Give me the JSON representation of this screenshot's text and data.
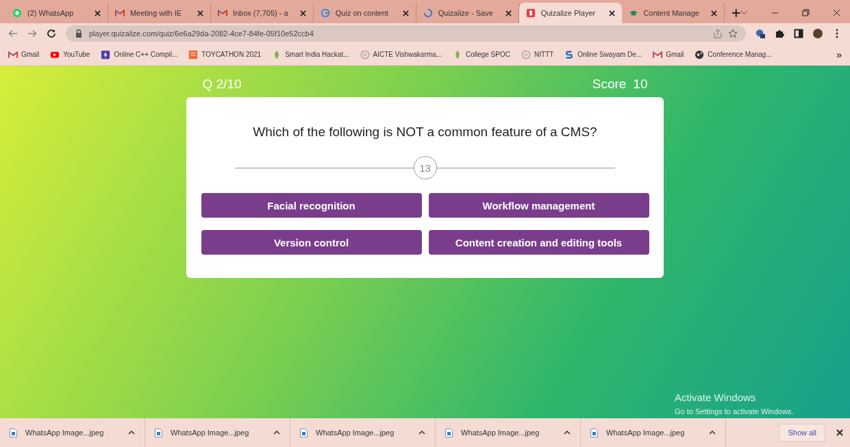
{
  "tabs": [
    {
      "title": "(2) WhatsApp",
      "kind": "whatsapp",
      "selected": false
    },
    {
      "title": "Meeting with IE",
      "kind": "gmail",
      "selected": false
    },
    {
      "title": "Inbox (7,705) - a",
      "kind": "gmail",
      "selected": false
    },
    {
      "title": "Quiz on content",
      "kind": "google",
      "selected": false
    },
    {
      "title": "Quizalize - Save",
      "kind": "loading",
      "selected": false
    },
    {
      "title": "Quizalize Player",
      "kind": "quizalize",
      "selected": true
    },
    {
      "title": "Content Manage",
      "kind": "cap",
      "selected": false
    }
  ],
  "address": {
    "url": "player.quizalize.com/quiz/6e6a29da-2082-4ce7-84fe-05f10e52ccb4"
  },
  "bookmarks": [
    {
      "label": "Gmail",
      "kind": "gmail"
    },
    {
      "label": "YouTube",
      "kind": "youtube"
    },
    {
      "label": "Online C++ Compil...",
      "kind": "compiler"
    },
    {
      "label": "TOYCATHON 2021",
      "kind": "toy"
    },
    {
      "label": "Smart India Hackat...",
      "kind": "leaf"
    },
    {
      "label": "AICTE Vishwakarma...",
      "kind": "globe"
    },
    {
      "label": "College SPOC",
      "kind": "leaf"
    },
    {
      "label": "NITTT",
      "kind": "globe"
    },
    {
      "label": "Online Swayam De...",
      "kind": "swayam"
    },
    {
      "label": "Gmail",
      "kind": "gmail"
    },
    {
      "label": "Conference Manag...",
      "kind": "world"
    }
  ],
  "bookmarks_more": "»",
  "quiz": {
    "progress": "Q 2/10",
    "score_label": "Score",
    "score": "10",
    "question": "Which of the following is NOT a common feature of a CMS?",
    "timer": "13",
    "answers": [
      "Facial recognition",
      "Workflow management",
      "Version control",
      "Content creation and editing tools"
    ]
  },
  "downloads": [
    "WhatsApp Image...jpeg",
    "WhatsApp Image...jpeg",
    "WhatsApp Image...jpeg",
    "WhatsApp Image...jpeg",
    "WhatsApp Image...jpeg"
  ],
  "show_all": "Show all",
  "os_notice": {
    "title": "Activate Windows",
    "text": "Go to Settings to activate Windows."
  }
}
